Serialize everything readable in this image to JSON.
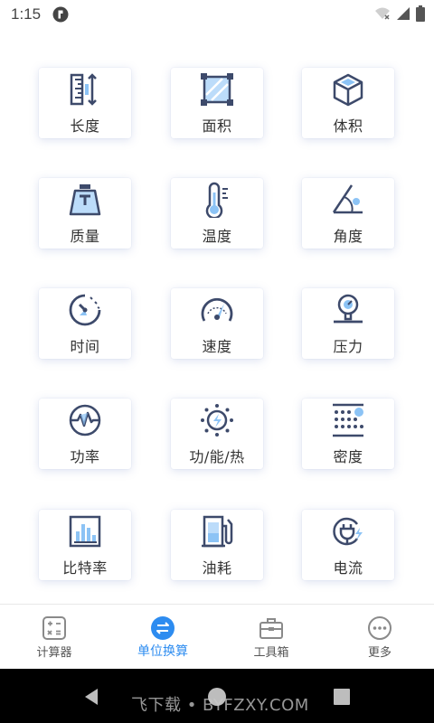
{
  "status": {
    "time": "1:15"
  },
  "grid": {
    "items": [
      {
        "label": "长度",
        "icon": "ruler-length-icon"
      },
      {
        "label": "面积",
        "icon": "area-square-icon"
      },
      {
        "label": "体积",
        "icon": "cube-volume-icon"
      },
      {
        "label": "质量",
        "icon": "weight-scale-icon"
      },
      {
        "label": "温度",
        "icon": "thermometer-icon"
      },
      {
        "label": "角度",
        "icon": "angle-icon"
      },
      {
        "label": "时间",
        "icon": "clock-icon"
      },
      {
        "label": "速度",
        "icon": "speedometer-icon"
      },
      {
        "label": "压力",
        "icon": "pressure-gauge-icon"
      },
      {
        "label": "功率",
        "icon": "power-pulse-icon"
      },
      {
        "label": "功/能/热",
        "icon": "energy-sun-bolt-icon"
      },
      {
        "label": "密度",
        "icon": "density-dots-icon"
      },
      {
        "label": "比特率",
        "icon": "bitrate-bars-icon"
      },
      {
        "label": "油耗",
        "icon": "fuel-pump-icon"
      },
      {
        "label": "电流",
        "icon": "electric-plug-icon"
      }
    ]
  },
  "bottom_nav": {
    "items": [
      {
        "label": "计算器",
        "icon": "calculator-icon",
        "active": false
      },
      {
        "label": "单位换算",
        "icon": "exchange-icon",
        "active": true
      },
      {
        "label": "工具箱",
        "icon": "toolbox-icon",
        "active": false
      },
      {
        "label": "更多",
        "icon": "more-icon",
        "active": false
      }
    ]
  },
  "watermark": "飞下载 • BYFZXY.COM",
  "colors": {
    "accent": "#2d8cf0",
    "icon_dark": "#3d4a6b",
    "icon_light": "#8cc3f5"
  }
}
